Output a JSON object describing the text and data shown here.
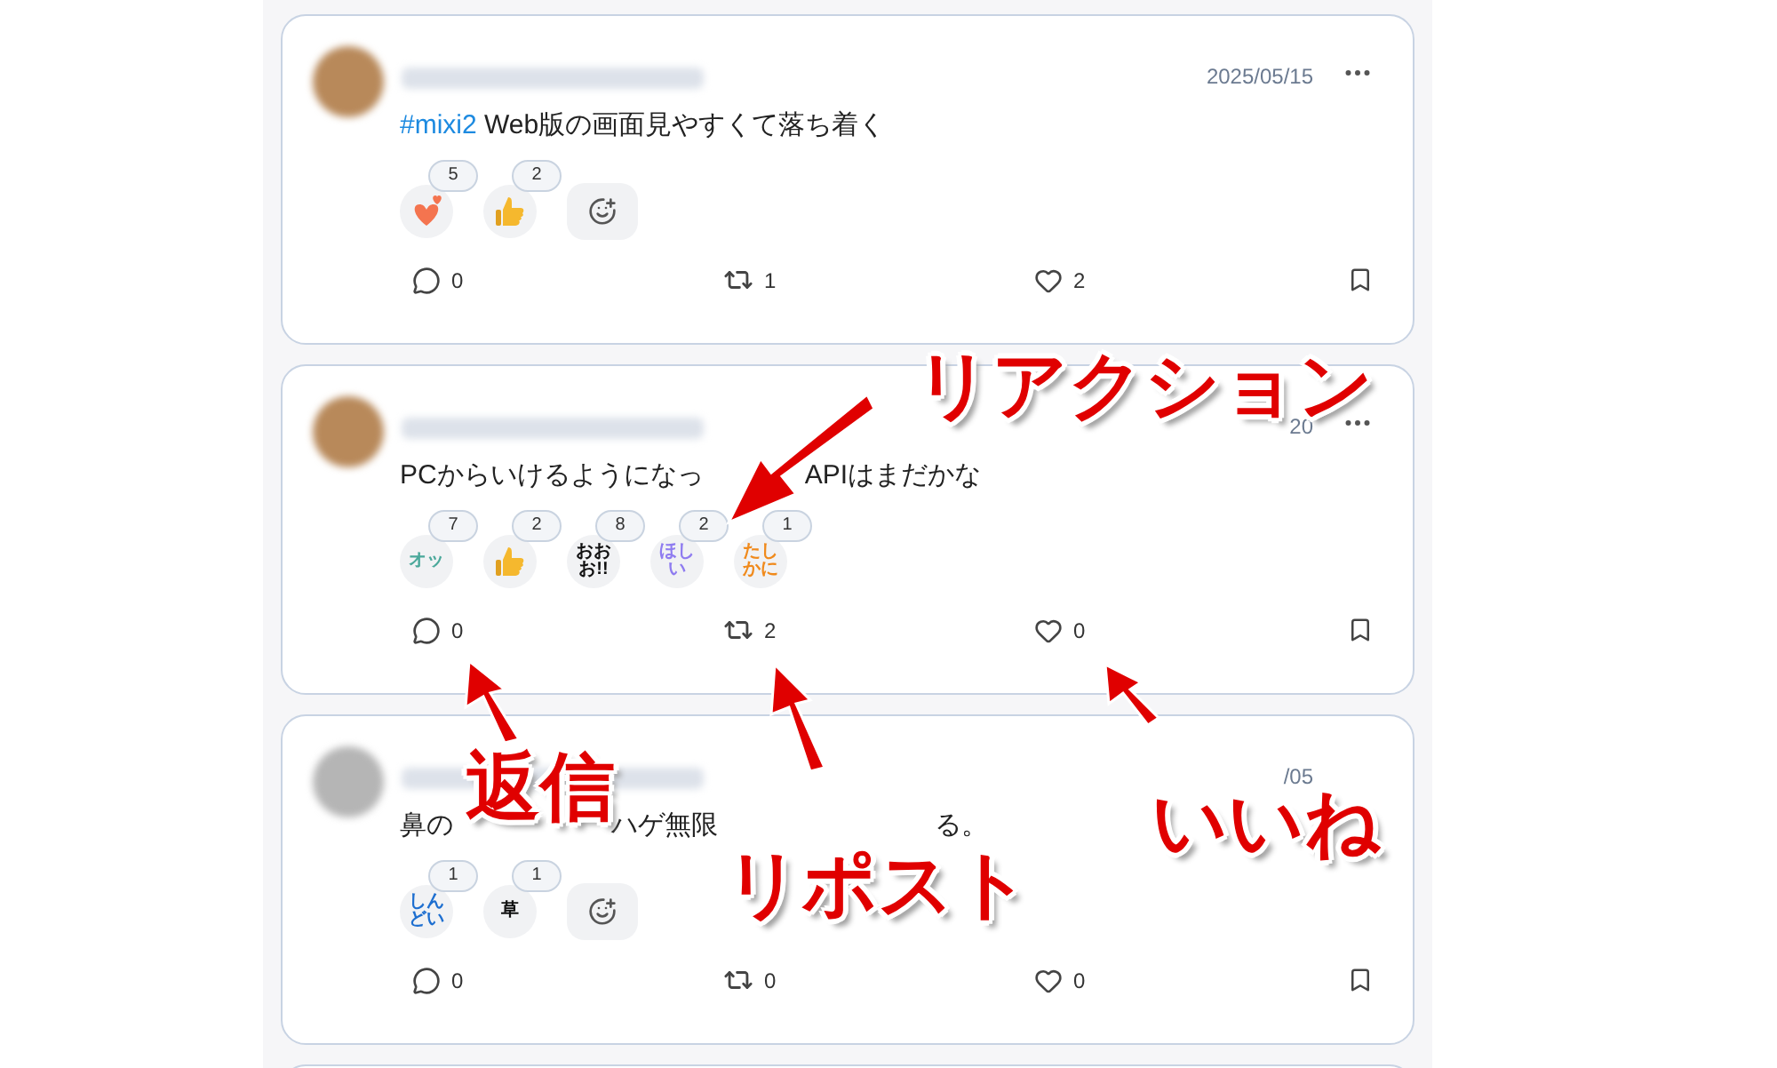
{
  "posts": [
    {
      "avatar": {
        "color": "#b8895a"
      },
      "date": "2025/05/15",
      "more_menu": true,
      "text_parts": [
        {
          "kind": "hashtag",
          "text": "#mixi2"
        },
        {
          "kind": "plain",
          "text": " Web版の画面見やすくて落ち着く"
        }
      ],
      "reactions": [
        {
          "kind": "hearts",
          "count": "5"
        },
        {
          "kind": "thumbs",
          "count": "2"
        }
      ],
      "add_reaction": true,
      "reply_count": "0",
      "repost_count": "1",
      "like_count": "2"
    },
    {
      "avatar": {
        "color": "#b8895a"
      },
      "date": "20",
      "more_menu": true,
      "text_parts": [
        {
          "kind": "plain",
          "text": "PCからいけるようになっ"
        },
        {
          "kind": "gap"
        },
        {
          "kind": "plain",
          "text": "APIはまだかな"
        }
      ],
      "reactions": [
        {
          "kind": "sticker",
          "label": "オッ",
          "color": "#4aa89a",
          "count": "7"
        },
        {
          "kind": "thumbs",
          "count": "2"
        },
        {
          "kind": "sticker",
          "label": "おおお!!",
          "color": "#111111",
          "count": "8"
        },
        {
          "kind": "sticker",
          "label": "ほしい",
          "color": "#8f7cf0",
          "count": "2"
        },
        {
          "kind": "sticker",
          "label": "たしかに",
          "color": "#f08a1c",
          "count": "1"
        }
      ],
      "add_reaction": false,
      "reply_count": "0",
      "repost_count": "2",
      "like_count": "0"
    },
    {
      "avatar": {
        "color": "#b5b5b5"
      },
      "date": "/05",
      "more_menu": false,
      "text_parts": [
        {
          "kind": "plain",
          "text": "鼻の"
        },
        {
          "kind": "wide_gap"
        },
        {
          "kind": "plain",
          "text": "ハゲ無限"
        },
        {
          "kind": "wider_gap"
        },
        {
          "kind": "plain",
          "text": "る。"
        }
      ],
      "reactions": [
        {
          "kind": "sticker",
          "label": "しんどい",
          "color": "#1e6fd0",
          "count": "1"
        },
        {
          "kind": "sticker",
          "label": "草",
          "color": "#111111",
          "count": "1"
        }
      ],
      "add_reaction": true,
      "reply_count": "0",
      "repost_count": "0",
      "like_count": "0"
    }
  ],
  "annotations": [
    {
      "kind": "reaction",
      "text": "リアクション"
    },
    {
      "kind": "reply",
      "text": "返信"
    },
    {
      "kind": "repost",
      "text": "リポスト"
    },
    {
      "kind": "like",
      "text": "いいね"
    }
  ]
}
